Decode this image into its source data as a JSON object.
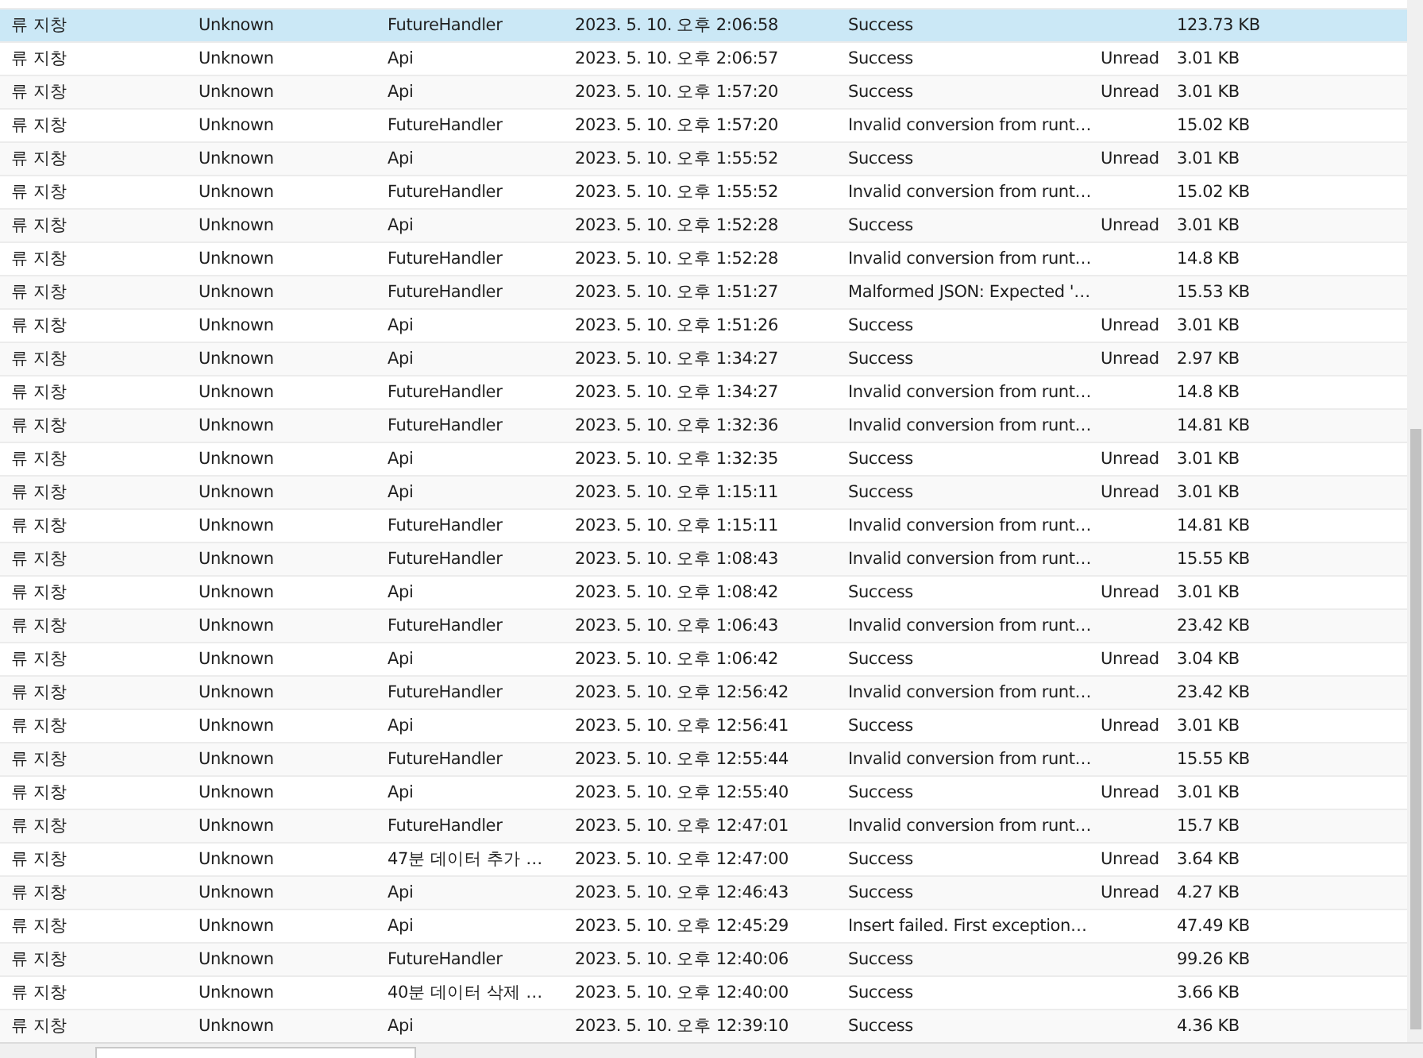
{
  "table": {
    "rows": [
      {
        "column_1": "류 지창",
        "column_2": "Unknown",
        "column_3": "FutureHandler",
        "column_4": "2023. 5. 10. 오후 2:06:58",
        "column_5": "Success",
        "column_7": "123.73 KB",
        "selected": true
      },
      {
        "column_1": "류 지창",
        "column_2": "Unknown",
        "column_3": "Api",
        "column_4": "2023. 5. 10. 오후 2:06:57",
        "column_5": "Success",
        "column_6": "Unread",
        "column_7": "3.01 KB",
        "selected": false
      },
      {
        "column_1": "류 지창",
        "column_2": "Unknown",
        "column_3": "Api",
        "column_4": "2023. 5. 10. 오후 1:57:20",
        "column_5": "Success",
        "column_6": "Unread",
        "column_7": "3.01 KB",
        "selected": false
      },
      {
        "column_1": "류 지창",
        "column_2": "Unknown",
        "column_3": "FutureHandler",
        "column_4": "2023. 5. 10. 오후 1:57:20",
        "column_5": "Invalid conversion from runt…",
        "column_7": "15.02 KB",
        "selected": false
      },
      {
        "column_1": "류 지창",
        "column_2": "Unknown",
        "column_3": "Api",
        "column_4": "2023. 5. 10. 오후 1:55:52",
        "column_5": "Success",
        "column_6": "Unread",
        "column_7": "3.01 KB",
        "selected": false
      },
      {
        "column_1": "류 지창",
        "column_2": "Unknown",
        "column_3": "FutureHandler",
        "column_4": "2023. 5. 10. 오후 1:55:52",
        "column_5": "Invalid conversion from runt…",
        "column_7": "15.02 KB",
        "selected": false
      },
      {
        "column_1": "류 지창",
        "column_2": "Unknown",
        "column_3": "Api",
        "column_4": "2023. 5. 10. 오후 1:52:28",
        "column_5": "Success",
        "column_6": "Unread",
        "column_7": "3.01 KB",
        "selected": false
      },
      {
        "column_1": "류 지창",
        "column_2": "Unknown",
        "column_3": "FutureHandler",
        "column_4": "2023. 5. 10. 오후 1:52:28",
        "column_5": "Invalid conversion from runt…",
        "column_7": "14.8 KB",
        "selected": false
      },
      {
        "column_1": "류 지창",
        "column_2": "Unknown",
        "column_3": "FutureHandler",
        "column_4": "2023. 5. 10. 오후 1:51:27",
        "column_5": "Malformed JSON: Expected '…",
        "column_7": "15.53 KB",
        "selected": false
      },
      {
        "column_1": "류 지창",
        "column_2": "Unknown",
        "column_3": "Api",
        "column_4": "2023. 5. 10. 오후 1:51:26",
        "column_5": "Success",
        "column_6": "Unread",
        "column_7": "3.01 KB",
        "selected": false
      },
      {
        "column_1": "류 지창",
        "column_2": "Unknown",
        "column_3": "Api",
        "column_4": "2023. 5. 10. 오후 1:34:27",
        "column_5": "Success",
        "column_6": "Unread",
        "column_7": "2.97 KB",
        "selected": false
      },
      {
        "column_1": "류 지창",
        "column_2": "Unknown",
        "column_3": "FutureHandler",
        "column_4": "2023. 5. 10. 오후 1:34:27",
        "column_5": "Invalid conversion from runt…",
        "column_7": "14.8 KB",
        "selected": false
      },
      {
        "column_1": "류 지창",
        "column_2": "Unknown",
        "column_3": "FutureHandler",
        "column_4": "2023. 5. 10. 오후 1:32:36",
        "column_5": "Invalid conversion from runt…",
        "column_7": "14.81 KB",
        "selected": false
      },
      {
        "column_1": "류 지창",
        "column_2": "Unknown",
        "column_3": "Api",
        "column_4": "2023. 5. 10. 오후 1:32:35",
        "column_5": "Success",
        "column_6": "Unread",
        "column_7": "3.01 KB",
        "selected": false
      },
      {
        "column_1": "류 지창",
        "column_2": "Unknown",
        "column_3": "Api",
        "column_4": "2023. 5. 10. 오후 1:15:11",
        "column_5": "Success",
        "column_6": "Unread",
        "column_7": "3.01 KB",
        "selected": false
      },
      {
        "column_1": "류 지창",
        "column_2": "Unknown",
        "column_3": "FutureHandler",
        "column_4": "2023. 5. 10. 오후 1:15:11",
        "column_5": "Invalid conversion from runt…",
        "column_7": "14.81 KB",
        "selected": false
      },
      {
        "column_1": "류 지창",
        "column_2": "Unknown",
        "column_3": "FutureHandler",
        "column_4": "2023. 5. 10. 오후 1:08:43",
        "column_5": "Invalid conversion from runt…",
        "column_7": "15.55 KB",
        "selected": false
      },
      {
        "column_1": "류 지창",
        "column_2": "Unknown",
        "column_3": "Api",
        "column_4": "2023. 5. 10. 오후 1:08:42",
        "column_5": "Success",
        "column_6": "Unread",
        "column_7": "3.01 KB",
        "selected": false
      },
      {
        "column_1": "류 지창",
        "column_2": "Unknown",
        "column_3": "FutureHandler",
        "column_4": "2023. 5. 10. 오후 1:06:43",
        "column_5": "Invalid conversion from runt…",
        "column_7": "23.42 KB",
        "selected": false
      },
      {
        "column_1": "류 지창",
        "column_2": "Unknown",
        "column_3": "Api",
        "column_4": "2023. 5. 10. 오후 1:06:42",
        "column_5": "Success",
        "column_6": "Unread",
        "column_7": "3.04 KB",
        "selected": false
      },
      {
        "column_1": "류 지창",
        "column_2": "Unknown",
        "column_3": "FutureHandler",
        "column_4": "2023. 5. 10. 오후 12:56:42",
        "column_5": "Invalid conversion from runt…",
        "column_7": "23.42 KB",
        "selected": false
      },
      {
        "column_1": "류 지창",
        "column_2": "Unknown",
        "column_3": "Api",
        "column_4": "2023. 5. 10. 오후 12:56:41",
        "column_5": "Success",
        "column_6": "Unread",
        "column_7": "3.01 KB",
        "selected": false
      },
      {
        "column_1": "류 지창",
        "column_2": "Unknown",
        "column_3": "FutureHandler",
        "column_4": "2023. 5. 10. 오후 12:55:44",
        "column_5": "Invalid conversion from runt…",
        "column_7": "15.55 KB",
        "selected": false
      },
      {
        "column_1": "류 지창",
        "column_2": "Unknown",
        "column_3": "Api",
        "column_4": "2023. 5. 10. 오후 12:55:40",
        "column_5": "Success",
        "column_6": "Unread",
        "column_7": "3.01 KB",
        "selected": false
      },
      {
        "column_1": "류 지창",
        "column_2": "Unknown",
        "column_3": "FutureHandler",
        "column_4": "2023. 5. 10. 오후 12:47:01",
        "column_5": "Invalid conversion from runt…",
        "column_7": "15.7 KB",
        "selected": false
      },
      {
        "column_1": "류 지창",
        "column_2": "Unknown",
        "column_3": "47분 데이터 추가 …",
        "column_4": "2023. 5. 10. 오후 12:47:00",
        "column_5": "Success",
        "column_6": "Unread",
        "column_7": "3.64 KB",
        "selected": false
      },
      {
        "column_1": "류 지창",
        "column_2": "Unknown",
        "column_3": "Api",
        "column_4": "2023. 5. 10. 오후 12:46:43",
        "column_5": "Success",
        "column_6": "Unread",
        "column_7": "4.27 KB",
        "selected": false
      },
      {
        "column_1": "류 지창",
        "column_2": "Unknown",
        "column_3": "Api",
        "column_4": "2023. 5. 10. 오후 12:45:29",
        "column_5": "Insert failed. First exception…",
        "column_7": "47.49 KB",
        "selected": false
      },
      {
        "column_1": "류 지창",
        "column_2": "Unknown",
        "column_3": "FutureHandler",
        "column_4": "2023. 5. 10. 오후 12:40:06",
        "column_5": "Success",
        "column_7": "99.26 KB",
        "selected": false
      },
      {
        "column_1": "류 지창",
        "column_2": "Unknown",
        "column_3": "40분 데이터 삭제 …",
        "column_4": "2023. 5. 10. 오후 12:40:00",
        "column_5": "Success",
        "column_7": "3.66 KB",
        "selected": false
      },
      {
        "column_1": "류 지창",
        "column_2": "Unknown",
        "column_3": "Api",
        "column_4": "2023. 5. 10. 오후 12:39:10",
        "column_5": "Success",
        "column_7": "4.36 KB",
        "selected": false
      }
    ]
  }
}
